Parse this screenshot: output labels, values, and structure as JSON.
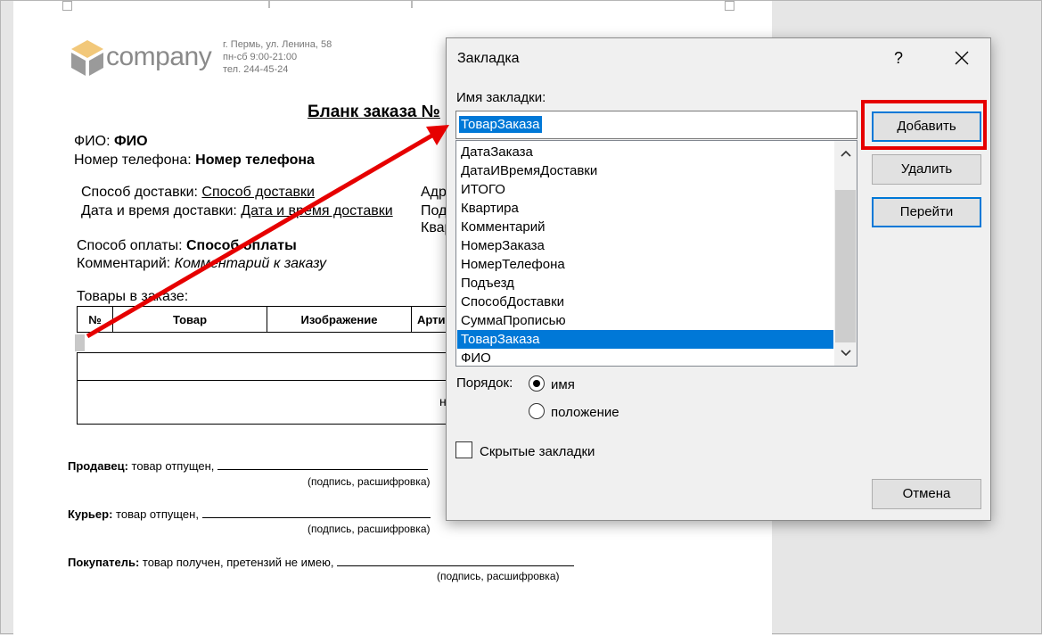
{
  "document": {
    "logo_text": "company",
    "address_lines": [
      "г. Пермь, ул. Ленина, 58",
      "пн-сб 9:00-21:00",
      "тел. 244-45-24"
    ],
    "title": "Бланк заказа №",
    "fio_label": "ФИО: ",
    "fio_value": "ФИО",
    "phone_label": "Номер телефона: ",
    "phone_value": "Номер телефона",
    "delivery_method_label": "Способ доставки: ",
    "delivery_method_value": "Способ доставки",
    "delivery_time_label": "Дата и время доставки: ",
    "delivery_time_value": "Дата и время доставки",
    "right_col_1": "Адре",
    "right_col_2": "Подъ",
    "right_col_3": "Квар",
    "payment_label": "Способ оплаты: ",
    "payment_value": "Способ оплаты",
    "comment_label": "Комментарий: ",
    "comment_value": "Комментарий к заказу",
    "items_label": "Товары в заказе:",
    "table_headers": [
      "№",
      "Товар",
      "Изображение",
      "Арти"
    ],
    "row_fragment": "н",
    "seller_label": "Продавец:",
    "seller_text": " товар отпущен, ",
    "courier_label": "Курьер:",
    "courier_text": " товар отпущен, ",
    "buyer_label": "Покупатель:",
    "buyer_text": " товар получен, претензий не имею, ",
    "signature_hint": "(подпись, расшифровка)"
  },
  "dialog": {
    "title": "Закладка",
    "help": "?",
    "name_label": "Имя закладки:",
    "name_value": "ТоварЗаказа",
    "bookmarks": [
      "ДатаЗаказа",
      "ДатаИВремяДоставки",
      "ИТОГО",
      "Квартира",
      "Комментарий",
      "НомерЗаказа",
      "НомерТелефона",
      "Подъезд",
      "СпособДоставки",
      "СуммаПрописью",
      "ТоварЗаказа",
      "ФИО"
    ],
    "selected_bookmark": "ТоварЗаказа",
    "buttons": {
      "add": "Добавить",
      "delete": "Удалить",
      "goto": "Перейти",
      "cancel": "Отмена"
    },
    "order_label": "Порядок:",
    "order_options": [
      "имя",
      "положение"
    ],
    "order_selected": "имя",
    "hidden_label": "Скрытые закладки",
    "hidden_checked": false
  },
  "colors": {
    "selection": "#0078d7",
    "highlight": "#e60000",
    "arrow": "#e60000"
  }
}
